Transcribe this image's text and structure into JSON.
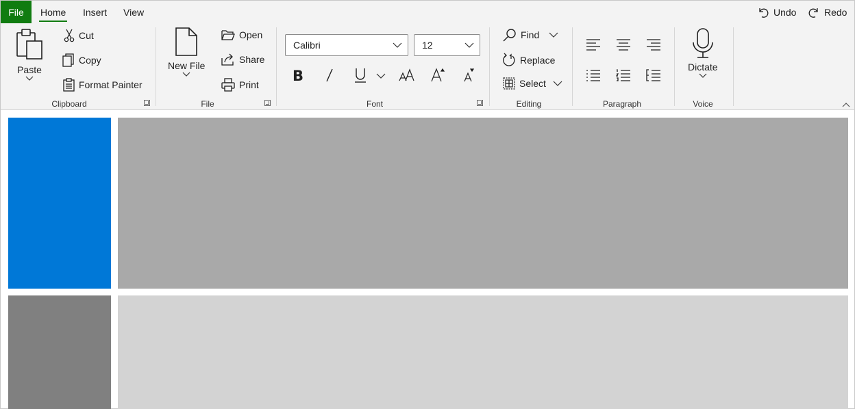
{
  "tabs": {
    "file": "File",
    "home": "Home",
    "insert": "Insert",
    "view": "View",
    "active": "Home"
  },
  "quick_access": {
    "undo": "Undo",
    "redo": "Redo"
  },
  "clipboard": {
    "paste": "Paste",
    "cut": "Cut",
    "copy": "Copy",
    "format_painter": "Format Painter",
    "label": "Clipboard"
  },
  "file_group": {
    "new_file": "New File",
    "open": "Open",
    "share": "Share",
    "print": "Print",
    "label": "File"
  },
  "font": {
    "family": "Calibri",
    "size": "12",
    "label": "Font"
  },
  "editing": {
    "find": "Find",
    "replace": "Replace",
    "select": "Select",
    "label": "Editing"
  },
  "paragraph": {
    "label": "Paragraph"
  },
  "voice": {
    "dictate": "Dictate",
    "label": "Voice"
  },
  "colors": {
    "file_tab": "#107c10",
    "accent_block": "#0078d7",
    "block_dark_gray": "#a9a9a9",
    "block_gray": "#808080",
    "block_light_gray": "#d3d3d3",
    "ribbon_bg": "#f3f3f3"
  }
}
